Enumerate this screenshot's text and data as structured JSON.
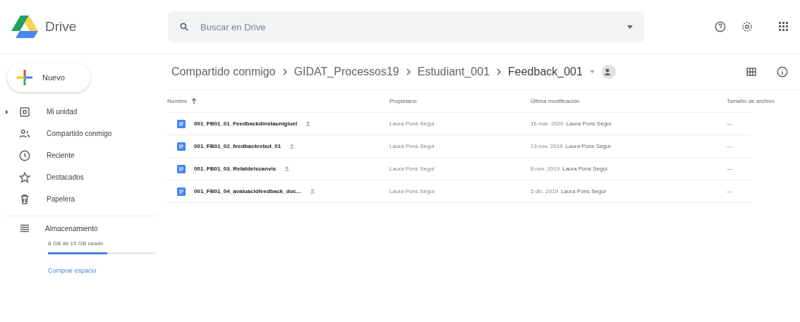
{
  "app": {
    "name": "Drive"
  },
  "search": {
    "placeholder": "Buscar en Drive"
  },
  "new_button": {
    "label": "Nuevo"
  },
  "sidebar": {
    "items": [
      {
        "label": "Mi unidad",
        "expandable": true
      },
      {
        "label": "Compartido conmigo",
        "expandable": false
      },
      {
        "label": "Reciente",
        "expandable": false
      },
      {
        "label": "Destacados",
        "expandable": false
      },
      {
        "label": "Papelera",
        "expandable": false
      }
    ]
  },
  "storage": {
    "label": "Almacenamiento",
    "usage": "8 GB de 15 GB usado",
    "level": 0.55,
    "buy_link": "Comprar espacio"
  },
  "breadcrumb": [
    "Compartido conmigo",
    "GIDAT_Processos19",
    "Estudiant_001",
    "Feedback_001"
  ],
  "table": {
    "columns": [
      "Nombre",
      "Propietario",
      "Última modificación",
      "Tamaño de archivo"
    ],
    "rows": [
      {
        "name": "001_FB01_01_Feedbackdinstaunigiuel",
        "owner": "Laura Pons Segui",
        "date": "16 mar. 2020",
        "modified_by": "Laura Pons Segui",
        "size": "—"
      },
      {
        "name": "001_FB01_02_feedbackrebut_01",
        "owner": "Laura Pons Segui",
        "date": "13 nov. 2019",
        "modified_by": "Laura Pons Segui",
        "size": "—"
      },
      {
        "name": "001_FB01_03_Retatdelscanvis",
        "owner": "Laura Pons Segui",
        "date": "8 nov. 2019",
        "modified_by": "Laura Pons Segui",
        "size": "—"
      },
      {
        "name": "001_FB01_04_avaluaciófeedback_doc...",
        "owner": "Laura Pons Segui",
        "date": "5 dic. 2019",
        "modified_by": "Laura Pons Segui",
        "size": "—"
      }
    ]
  }
}
